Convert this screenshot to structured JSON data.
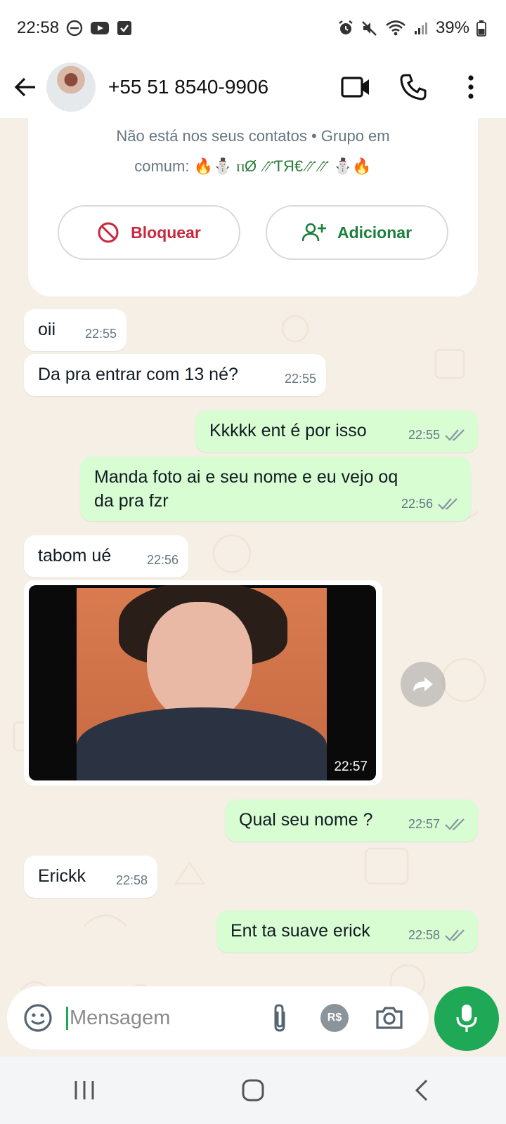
{
  "status_bar": {
    "time": "22:58",
    "battery": "39%"
  },
  "header": {
    "contact_name": "+55 51 8540-9906"
  },
  "info_card": {
    "text_line1": "Não está nos seus contatos • Grupo em",
    "text_line2_prefix": "comum: ",
    "group_name": "🔥⛄ ⲡØ ⳼ƬЯ€⳼⳼ ⛄🔥",
    "block_label": "Bloquear",
    "add_label": "Adicionar"
  },
  "messages": [
    {
      "dir": "in",
      "text": "oii",
      "time": "22:55"
    },
    {
      "dir": "in",
      "text": "Da pra entrar com 13 né?",
      "time": "22:55"
    },
    {
      "dir": "out",
      "text": "Kkkkk ent é por isso",
      "time": "22:55"
    },
    {
      "dir": "out",
      "text_line1": "Manda foto ai e seu nome e eu vejo oq",
      "text_line2": "da pra fzr",
      "time": "22:56"
    },
    {
      "dir": "in",
      "text": "tabom ué",
      "time": "22:56"
    },
    {
      "dir": "in",
      "type": "photo",
      "time": "22:57"
    },
    {
      "dir": "out",
      "text": "Qual seu nome ?",
      "time": "22:57"
    },
    {
      "dir": "in",
      "text": "Erickk",
      "time": "22:58"
    },
    {
      "dir": "out",
      "text": "Ent ta suave erick",
      "time": "22:58"
    }
  ],
  "input": {
    "placeholder": "Mensagem",
    "currency_badge": "R$"
  },
  "colors": {
    "accent": "#1fa855",
    "outgoing_bubble": "#d9fdd3",
    "chat_bg": "#f5efe6",
    "block_red": "#c8283d"
  }
}
